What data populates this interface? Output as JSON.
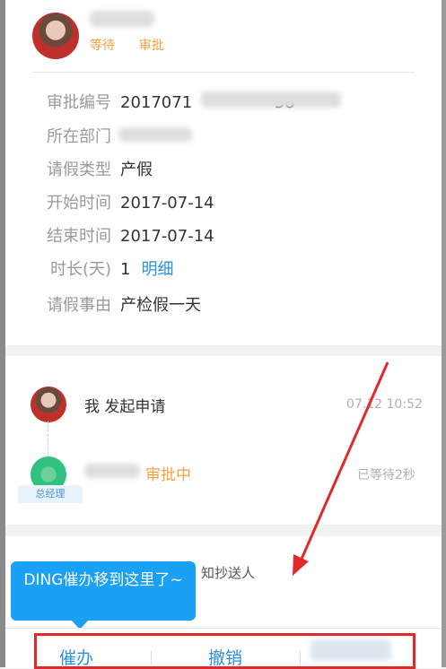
{
  "header": {
    "status_text": "等待      审批"
  },
  "details": {
    "rows": [
      {
        "label": "审批编号",
        "value": "2017071                58"
      },
      {
        "label": "所在部门",
        "value": ""
      },
      {
        "label": "请假类型",
        "value": "产假"
      },
      {
        "label": "开始时间",
        "value": "2017-07-14"
      },
      {
        "label": "结束时间",
        "value": "2017-07-14"
      },
      {
        "label": "时长(天)",
        "value": "1",
        "link": "明细"
      },
      {
        "label": "请假事由",
        "value": "产检假一天"
      }
    ]
  },
  "flow": {
    "step1_text": "我 发起申请",
    "step1_time": "07.12 10:52",
    "step2_status": "审批中",
    "step2_wait": "已等待2秒",
    "step2_role": "总经理"
  },
  "cc": {
    "text": "知抄送人"
  },
  "tooltip": {
    "text": "DING催办移到这里了~"
  },
  "actions": {
    "remind": "催办",
    "revoke": "撤销"
  },
  "colors": {
    "accent_blue": "#2f8fe3",
    "pending_orange": "#f0a33d",
    "tooltip_blue": "#1aa0f5",
    "highlight_red": "#e02a2a"
  }
}
